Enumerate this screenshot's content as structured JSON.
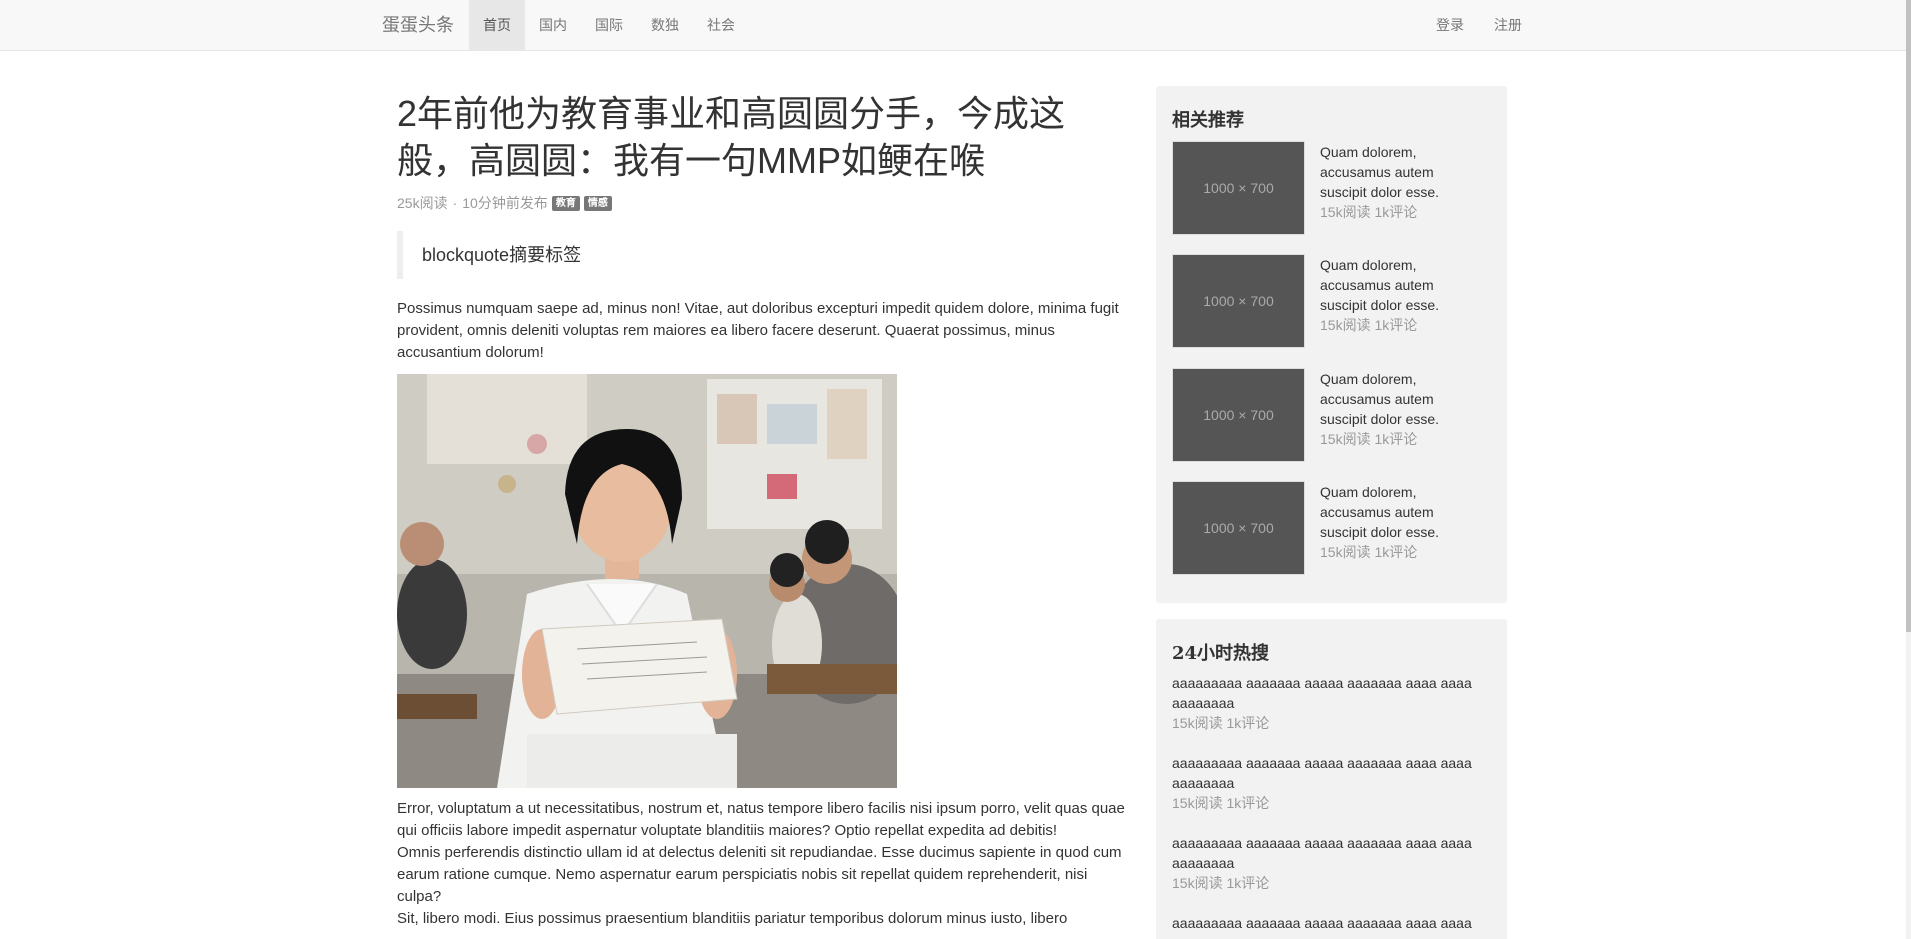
{
  "navbar": {
    "brand": "蛋蛋头条",
    "items": [
      "首页",
      "国内",
      "国际",
      "数独",
      "社会"
    ],
    "right": [
      "登录",
      "注册"
    ]
  },
  "article": {
    "title": "2年前他为教育事业和高圆圆分手，今成这般，高圆圆：我有一句MMP如鲠在喉",
    "reads": "25k阅读",
    "sep": "·",
    "time": "10分钟前发布",
    "tags": [
      "教育",
      "情感"
    ],
    "blockquote": "blockquote摘要标签",
    "p1": "Possimus numquam saepe ad, minus non! Vitae, aut doloribus excepturi impedit quidem dolore, minima fugit provident, omnis deleniti voluptas rem maiores ea libero facere deserunt. Quaerat possimus, minus accusantium dolorum!",
    "p2": "Error, voluptatum a ut necessitatibus, nostrum et, natus tempore libero facilis nisi ipsum porro, velit quas quae qui officiis labore impedit aspernatur voluptate blanditiis maiores? Optio repellat expedita ad debitis!",
    "p3": "Omnis perferendis distinctio ullam id at delectus deleniti sit repudiandae. Esse ducimus sapiente in quod cum earum ratione cumque. Nemo aspernatur earum perspiciatis nobis sit repellat quidem reprehenderit, nisi culpa?",
    "p4": "Sit, libero modi. Eius possimus praesentium blanditiis pariatur temporibus dolorum minus iusto, libero"
  },
  "recommend": {
    "title": "相关推荐",
    "items": [
      {
        "thumb": "1000 × 700",
        "text": "Quam dolorem, accusamus autem suscipit dolor esse.",
        "stats": "15k阅读 1k评论"
      },
      {
        "thumb": "1000 × 700",
        "text": "Quam dolorem, accusamus autem suscipit dolor esse.",
        "stats": "15k阅读 1k评论"
      },
      {
        "thumb": "1000 × 700",
        "text": "Quam dolorem, accusamus autem suscipit dolor esse.",
        "stats": "15k阅读 1k评论"
      },
      {
        "thumb": "1000 × 700",
        "text": "Quam dolorem, accusamus autem suscipit dolor esse.",
        "stats": "15k阅读 1k评论"
      }
    ]
  },
  "hot": {
    "title": "24小时热搜",
    "items": [
      {
        "text": "aaaaaaaaa aaaaaaa aaaaa aaaaaaa aaaa aaaa aaaaaaaa",
        "stats": "15k阅读 1k评论"
      },
      {
        "text": "aaaaaaaaa aaaaaaa aaaaa aaaaaaa aaaa aaaa aaaaaaaa",
        "stats": "15k阅读 1k评论"
      },
      {
        "text": "aaaaaaaaa aaaaaaa aaaaa aaaaaaa aaaa aaaa aaaaaaaa",
        "stats": "15k阅读 1k评论"
      },
      {
        "text": "aaaaaaaaa aaaaaaa aaaaa aaaaaaa aaaa aaaa",
        "stats": ""
      }
    ]
  }
}
